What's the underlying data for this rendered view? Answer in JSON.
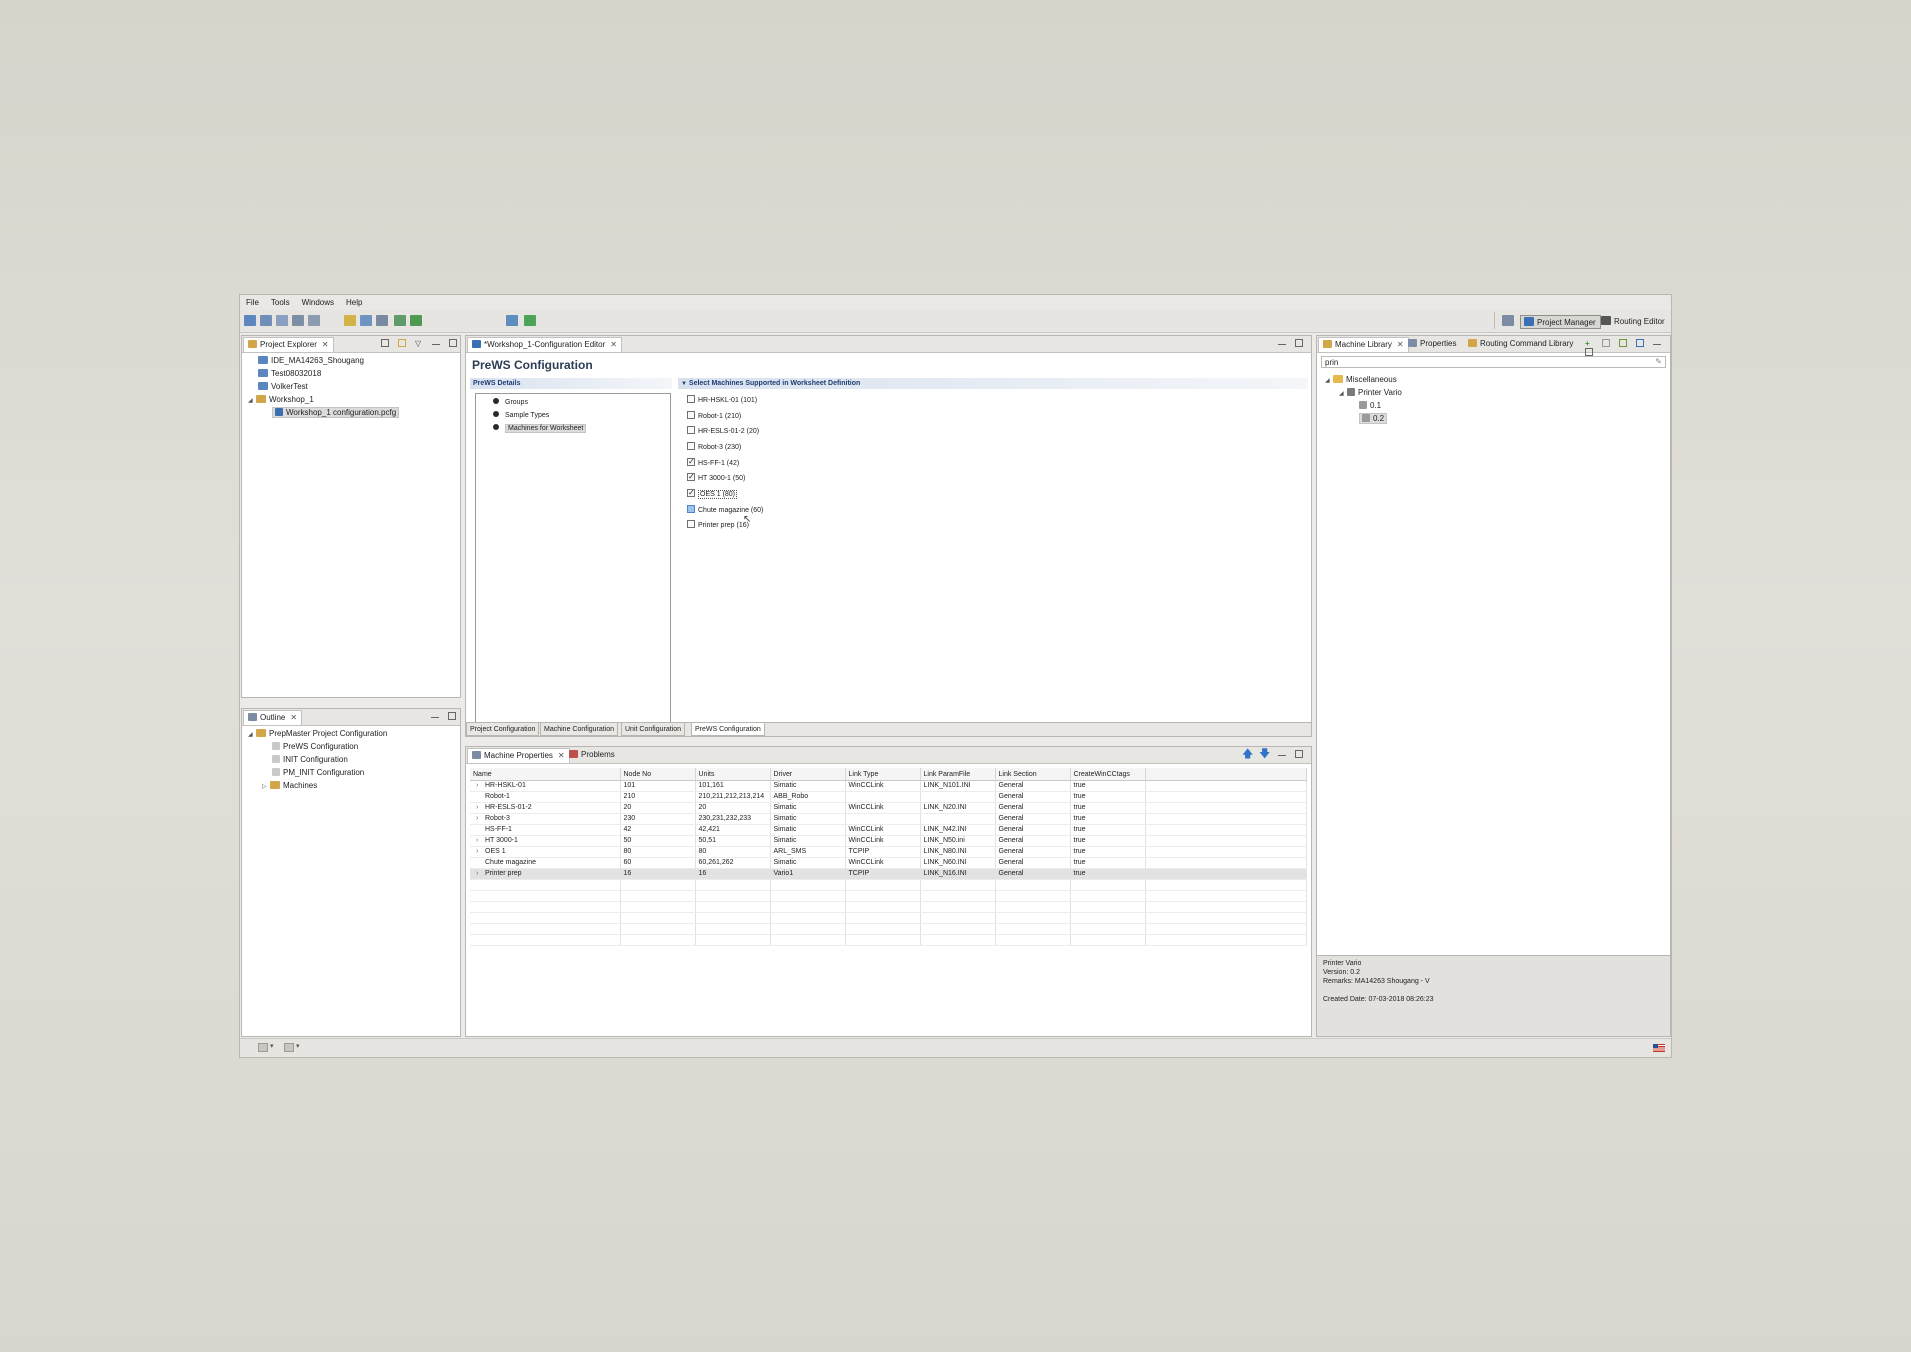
{
  "menu": [
    "File",
    "Tools",
    "Windows",
    "Help"
  ],
  "perspectives": {
    "project_manager": "Project Manager",
    "routing_editor": "Routing Editor"
  },
  "project_explorer": {
    "tab": "Project Explorer",
    "items": [
      "IDE_MA14263_Shougang",
      "Test08032018",
      "VolkerTest",
      "Workshop_1",
      "Workshop_1 configuration.pcfg"
    ]
  },
  "outline": {
    "tab": "Outline",
    "items": [
      "PrepMaster Project Configuration",
      "PreWS Configuration",
      "INIT Configuration",
      "PM_INIT Configuration",
      "Machines"
    ]
  },
  "editor": {
    "tab": "*Workshop_1-Configuration Editor",
    "title": "PreWS Configuration",
    "details_head": "PreWS Details",
    "details_items": [
      "Groups",
      "Sample Types",
      "Machines for Worksheet"
    ],
    "machines_head": "Select Machines Supported in Worksheet  Definition",
    "machines": [
      {
        "label": "HR-HSKL-01 (101)",
        "checked": false
      },
      {
        "label": "Robot-1 (210)",
        "checked": false
      },
      {
        "label": "HR-ESLS-01-2 (20)",
        "checked": false
      },
      {
        "label": "Robot-3 (230)",
        "checked": false
      },
      {
        "label": "HS-FF-1 (42)",
        "checked": true
      },
      {
        "label": "HT 3000-1 (50)",
        "checked": true
      },
      {
        "label": "OES 1 (80)",
        "checked": true
      },
      {
        "label": "Chute magazine (60)",
        "checked": false
      },
      {
        "label": "Printer prep (16)",
        "checked": false
      }
    ],
    "bottom_tabs": [
      "Project Configuration",
      "Machine Configuration",
      "Unit Configuration",
      "PreWS Configuration"
    ]
  },
  "machine_library": {
    "tabs": [
      "Machine Library",
      "Properties",
      "Routing Command Library"
    ],
    "search_value": "prin",
    "tree": [
      "Miscellaneous",
      "Printer Vario",
      "0.1",
      "0.2"
    ],
    "info": [
      "Printer Vario",
      "Version: 0.2",
      "Remarks: MA14263 Shougang - V",
      "Created Date: 07-03-2018 08:26:23"
    ]
  },
  "machine_properties": {
    "tabs": [
      "Machine Properties",
      "Problems"
    ],
    "columns": [
      "Name",
      "Node No",
      "Units",
      "Driver",
      "Link Type",
      "Link ParamFile",
      "Link Section",
      "CreateWinCCtags"
    ],
    "rows": [
      [
        "HR-HSKL-01",
        "101",
        "101,161",
        "Simatic",
        "WinCCLink",
        "LINK_N101.INI",
        "General",
        "true"
      ],
      [
        "Robot-1",
        "210",
        "210,211,212,213,214",
        "ABB_Robo",
        "",
        "",
        "General",
        "true"
      ],
      [
        "HR-ESLS-01-2",
        "20",
        "20",
        "Simatic",
        "WinCCLink",
        "LINK_N20.INI",
        "General",
        "true"
      ],
      [
        "Robot-3",
        "230",
        "230,231,232,233",
        "Simatic",
        "",
        "",
        "General",
        "true"
      ],
      [
        "HS-FF-1",
        "42",
        "42,421",
        "Simatic",
        "WinCCLink",
        "LINK_N42.INI",
        "General",
        "true"
      ],
      [
        "HT 3000-1",
        "50",
        "50,51",
        "Simatic",
        "WinCCLink",
        "LINK_N50.ini",
        "General",
        "true"
      ],
      [
        "OES 1",
        "80",
        "80",
        "ARL_SMS",
        "TCPIP",
        "LINK_N80.INI",
        "General",
        "true"
      ],
      [
        "Chute magazine",
        "60",
        "60,261,262",
        "Simatic",
        "WinCCLink",
        "LINK_N60.INI",
        "General",
        "true"
      ],
      [
        "Printer prep",
        "16",
        "16",
        "Vario1",
        "TCPIP",
        "LINK_N16.INI",
        "General",
        "true"
      ]
    ]
  },
  "colors": {
    "accent": "#3b6fb3",
    "section_text": "#1e3d73",
    "folder": "#e5b94e"
  }
}
